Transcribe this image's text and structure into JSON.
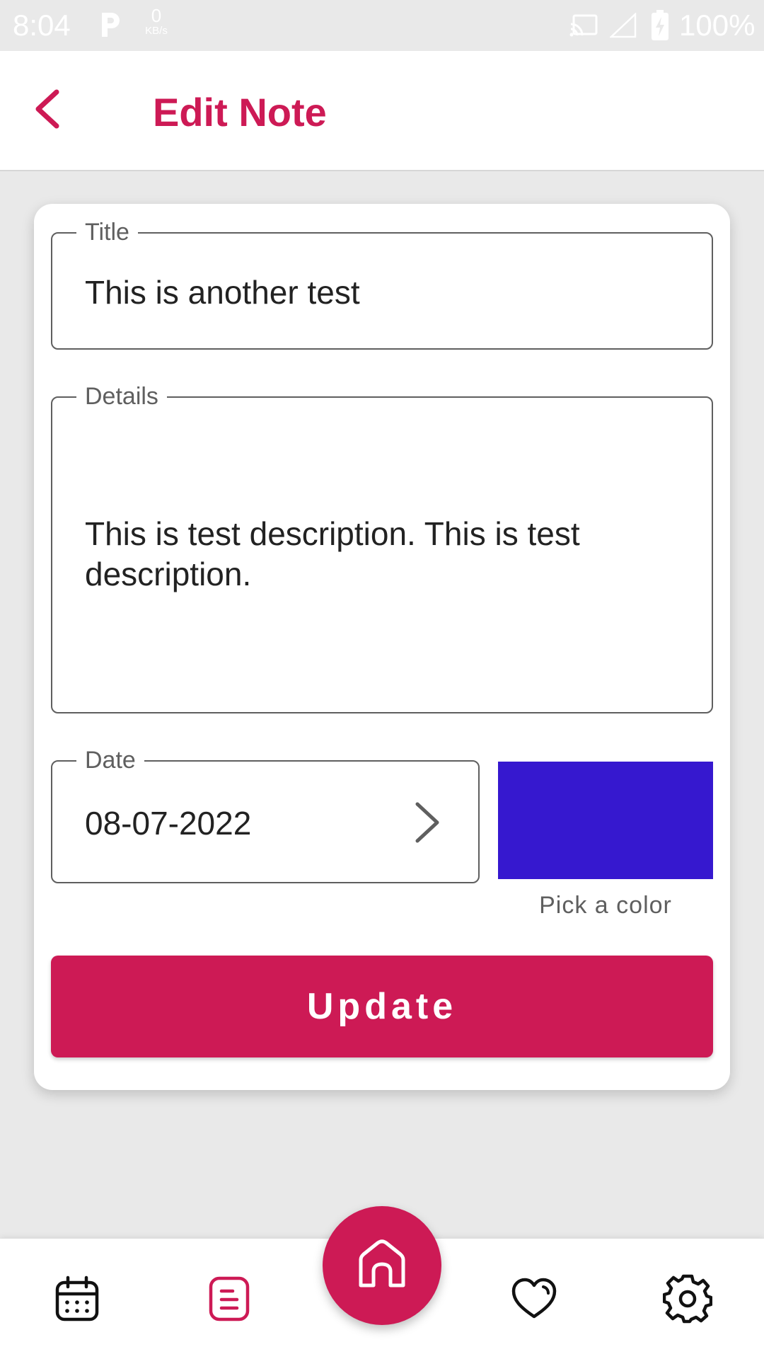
{
  "status_bar": {
    "time": "8:04",
    "speed_value": "0",
    "speed_unit": "KB/s",
    "battery": "100%"
  },
  "header": {
    "title": "Edit Note",
    "back_icon": "chevron-left-icon"
  },
  "form": {
    "title_label": "Title",
    "title_value": "This is another test",
    "details_label": "Details",
    "details_value": "This is test description. This is test description.",
    "date_label": "Date",
    "date_value": "08-07-2022",
    "color_label": "Pick a color",
    "selected_color": "#3618cf",
    "submit_label": "Update"
  },
  "bottom_nav": {
    "items": [
      "calendar-icon",
      "notes-icon",
      "home-icon",
      "heart-icon",
      "gear-icon"
    ],
    "active": "notes-icon"
  },
  "colors": {
    "accent": "#cd1a55",
    "text_dark": "#222222",
    "outline": "#5f5f5f"
  }
}
